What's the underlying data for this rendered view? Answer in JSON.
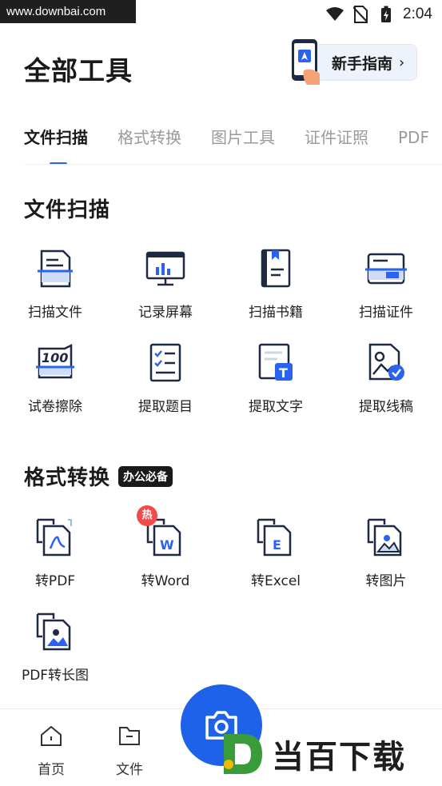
{
  "watermark_url": "www.downbai.com",
  "status": {
    "time": "2:04"
  },
  "page_title": "全部工具",
  "guide_button": {
    "label": "新手指南",
    "chevron": "›"
  },
  "tabs": [
    {
      "label": "文件扫描"
    },
    {
      "label": "格式转换"
    },
    {
      "label": "图片工具"
    },
    {
      "label": "证件证照"
    },
    {
      "label": "PDF"
    }
  ],
  "sections": {
    "scan": {
      "title": "文件扫描",
      "tools": [
        {
          "label": "扫描文件",
          "icon": "scan-document-icon"
        },
        {
          "label": "记录屏幕",
          "icon": "record-screen-icon"
        },
        {
          "label": "扫描书籍",
          "icon": "scan-book-icon"
        },
        {
          "label": "扫描证件",
          "icon": "scan-id-card-icon"
        },
        {
          "label": "试卷擦除",
          "icon": "erase-exam-icon"
        },
        {
          "label": "提取题目",
          "icon": "extract-questions-icon"
        },
        {
          "label": "提取文字",
          "icon": "extract-text-icon"
        },
        {
          "label": "提取线稿",
          "icon": "extract-line-art-icon"
        }
      ]
    },
    "convert": {
      "title": "格式转换",
      "badge": "办公必备",
      "tools": [
        {
          "label": "转PDF",
          "icon": "to-pdf-icon"
        },
        {
          "label": "转Word",
          "icon": "to-word-icon",
          "hot": "热"
        },
        {
          "label": "转Excel",
          "icon": "to-excel-icon"
        },
        {
          "label": "转图片",
          "icon": "to-image-icon"
        },
        {
          "label": "PDF转长图",
          "icon": "pdf-to-long-image-icon"
        }
      ]
    }
  },
  "bottom_nav": [
    {
      "label": "首页",
      "icon": "home-icon"
    },
    {
      "label": "文件",
      "icon": "folder-icon"
    }
  ],
  "camera_icon": "camera-icon",
  "watermark_logo_text": "当百下载",
  "colors": {
    "accent": "#2a62f2",
    "camera": "#1f62ea",
    "hot": "#f44a4a",
    "icon_dark": "#1e2a44"
  }
}
